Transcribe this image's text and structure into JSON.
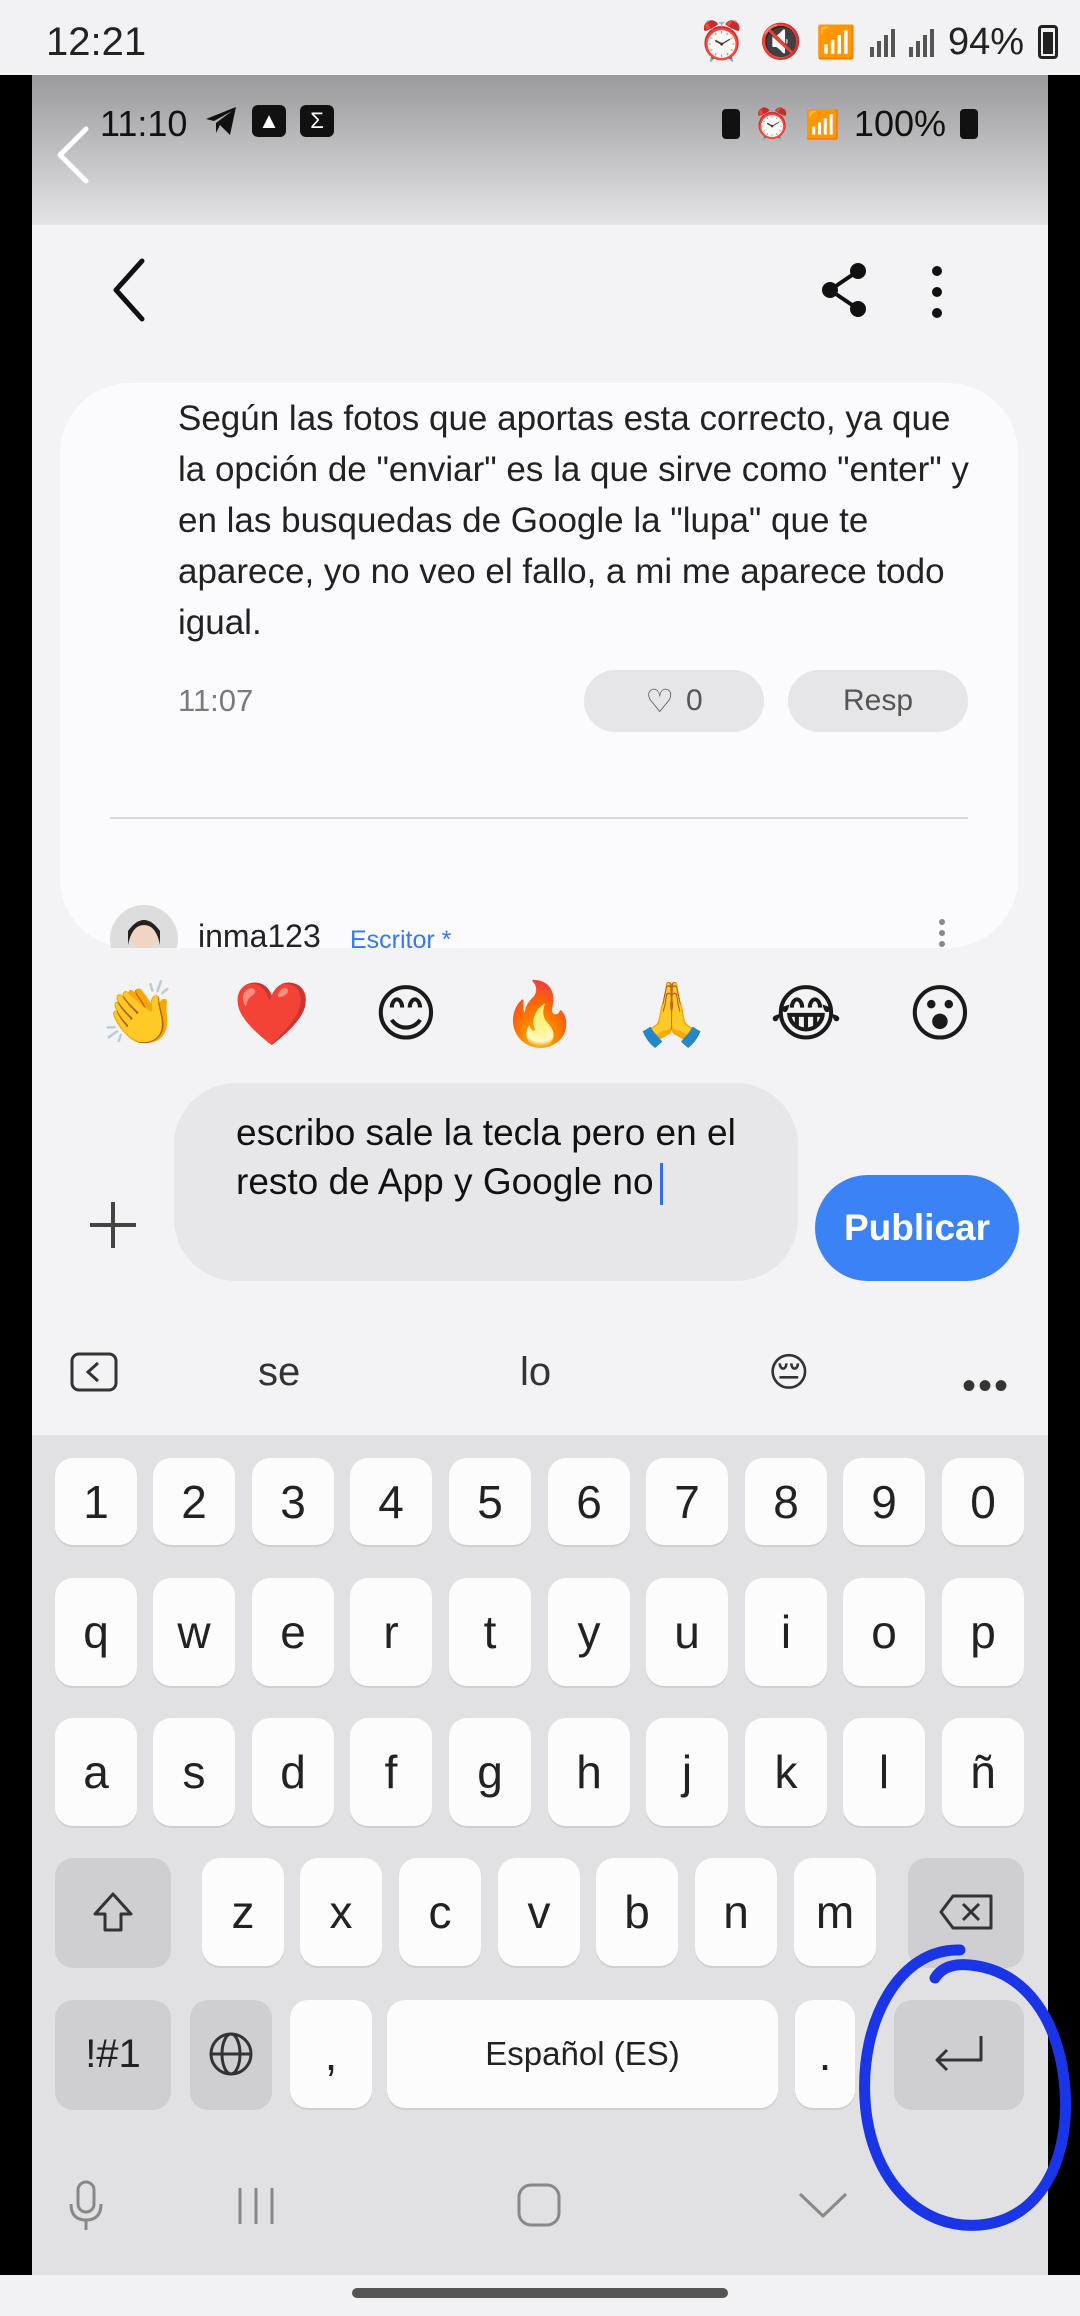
{
  "outer_status": {
    "time": "12:21",
    "battery": "94%"
  },
  "inner_status": {
    "time": "11:10",
    "battery": "100%"
  },
  "comment": {
    "text": "Según las fotos que aportas esta correcto, ya que la opción de \"enviar\" es la que sirve como \"enter\" y en las busquedas de Google la \"lupa\" que te aparece, yo no veo el fallo, a mi me aparece todo igual.",
    "time": "11:07",
    "likes": "0",
    "reply_label": "Resp"
  },
  "next_comment": {
    "username": "inma123",
    "badge": "Escritor *"
  },
  "emojis": [
    "👏",
    "❤️",
    "😊",
    "🔥",
    "🙏",
    "😂",
    "😮"
  ],
  "composer": {
    "text": "escribo sale la tecla pero en el resto de App y Google no",
    "publish_label": "Publicar"
  },
  "suggestions": [
    "se",
    "lo",
    "😔"
  ],
  "keyboard": {
    "row_numbers": [
      "1",
      "2",
      "3",
      "4",
      "5",
      "6",
      "7",
      "8",
      "9",
      "0"
    ],
    "row1": [
      "q",
      "w",
      "e",
      "r",
      "t",
      "y",
      "u",
      "i",
      "o",
      "p"
    ],
    "row2": [
      "a",
      "s",
      "d",
      "f",
      "g",
      "h",
      "j",
      "k",
      "l",
      "ñ"
    ],
    "row3": [
      "z",
      "x",
      "c",
      "v",
      "b",
      "n",
      "m"
    ],
    "symbols_label": "!#1",
    "comma": ",",
    "space_label": "Español (ES)",
    "period": "."
  },
  "colors": {
    "accent": "#3b82f6",
    "annotation": "#1a35e8"
  }
}
